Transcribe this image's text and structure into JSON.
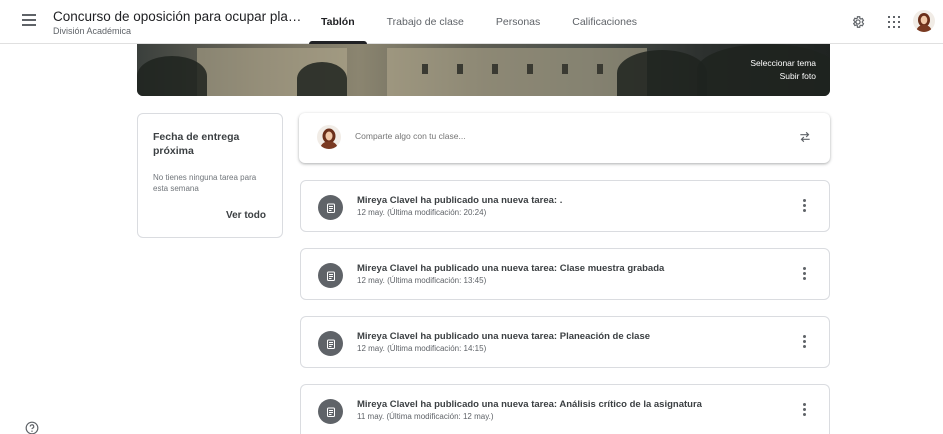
{
  "header": {
    "menu_icon": "hamburger-menu-icon",
    "class_title": "Concurso de oposición para ocupar plazas de ...",
    "class_subtitle": "División Académica",
    "tabs": [
      {
        "label": "Tablón",
        "active": true
      },
      {
        "label": "Trabajo de clase",
        "active": false
      },
      {
        "label": "Personas",
        "active": false
      },
      {
        "label": "Calificaciones",
        "active": false
      }
    ],
    "icons": [
      "gear-icon",
      "apps-grid-icon",
      "account-avatar"
    ]
  },
  "banner": {
    "select_theme": "Seleccionar tema",
    "upload_photo": "Subir foto"
  },
  "upcoming": {
    "title": "Fecha de entrega próxima",
    "message": "No tienes ninguna tarea para esta semana",
    "view_all": "Ver todo"
  },
  "share": {
    "placeholder": "Comparte algo con tu clase..."
  },
  "stream": [
    {
      "title": "Mireya Clavel ha publicado una nueva tarea: .",
      "date": "12 may. (Última modificación: 20:24)"
    },
    {
      "title": "Mireya Clavel ha publicado una nueva tarea: Clase muestra grabada",
      "date": "12 may. (Última modificación: 13:45)"
    },
    {
      "title": "Mireya Clavel ha publicado una nueva tarea: Planeación de clase",
      "date": "12 may. (Última modificación: 14:15)"
    },
    {
      "title": "Mireya Clavel ha publicado una nueva tarea: Análisis crítico de la asignatura",
      "date": "11 may. (Última modificación: 12 may.)"
    }
  ],
  "colors": {
    "icon_gray": "#5f6368",
    "text_dark": "#202124",
    "border": "#dadce0"
  }
}
